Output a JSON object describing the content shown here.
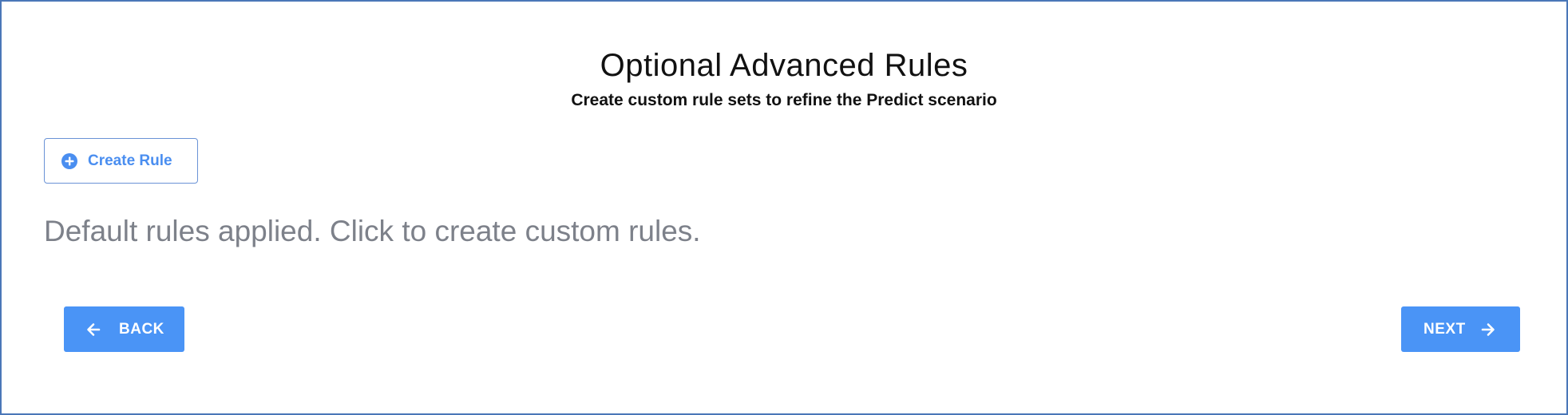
{
  "header": {
    "title": "Optional Advanced Rules",
    "subtitle": "Create custom rule sets to refine the Predict scenario"
  },
  "actions": {
    "create_rule_label": "Create Rule",
    "create_rule_icon": "plus-circle-icon"
  },
  "status": {
    "message": "Default rules applied. Click to create custom rules."
  },
  "navigation": {
    "back_label": "BACK",
    "back_icon": "arrow-left-icon",
    "next_label": "NEXT",
    "next_icon": "arrow-right-icon"
  },
  "colors": {
    "accent": "#4a94f6",
    "border": "#4a77b8",
    "muted_text": "#7d818a"
  }
}
